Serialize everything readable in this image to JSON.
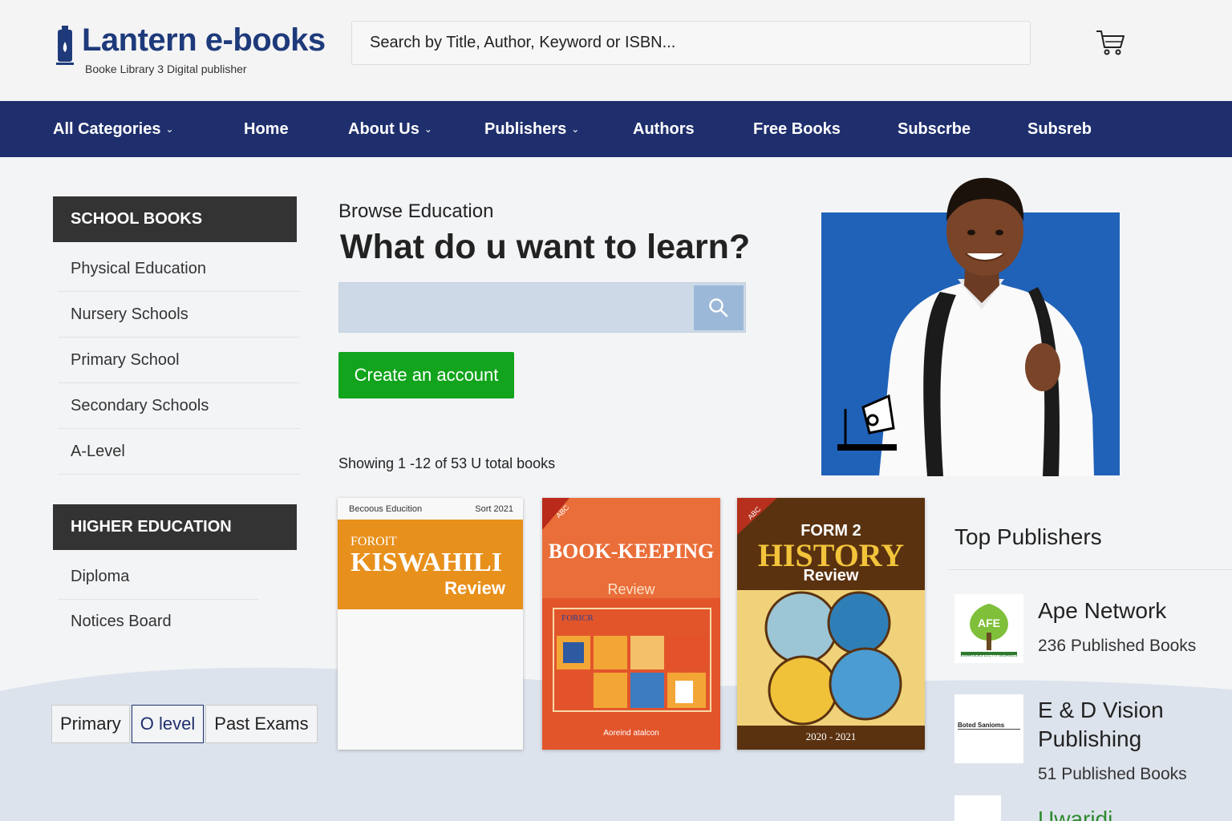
{
  "header": {
    "logo_title": "Lantern e-books",
    "logo_subtitle": "Booke Library 3 Digital publisher",
    "search_placeholder": "Search by Title, Author, Keyword or ISBN..."
  },
  "nav": {
    "items": [
      {
        "label": "All Categories",
        "dropdown": true
      },
      {
        "label": "Home",
        "dropdown": false
      },
      {
        "label": "About Us",
        "dropdown": true
      },
      {
        "label": "Publishers",
        "dropdown": true
      },
      {
        "label": "Authors",
        "dropdown": false
      },
      {
        "label": "Free Books",
        "dropdown": false
      },
      {
        "label": "Subscrbe",
        "dropdown": false
      },
      {
        "label": "Subsreb",
        "dropdown": false
      }
    ]
  },
  "sidebar": {
    "school_header": "SCHOOL BOOKS",
    "school_items": [
      "Physical Education",
      "Nursery Schools",
      "Primary School",
      "Secondary Schools",
      "A-Level"
    ],
    "higher_header": "HIGHER EDUCATION",
    "higher_items": [
      "Diploma",
      "Notices Board"
    ]
  },
  "tabs": [
    {
      "label": "Primary",
      "active": false
    },
    {
      "label": "O level",
      "active": true
    },
    {
      "label": "Past Exams",
      "active": false
    }
  ],
  "hero": {
    "browse_label": "Browse Education",
    "title": "What do u want to learn?",
    "create_account": "Create an account",
    "showing": "Showing 1 -12 of 53 U total books"
  },
  "books": [
    {
      "top_left": "Becoous Educition",
      "top_right": "Sort 2021",
      "kicker": "FOROIT",
      "title": "KISWAHILI",
      "subtitle": "Review",
      "color": "#e8901c"
    },
    {
      "badge": "ABC",
      "title": "BOOK-KEEPING",
      "subtitle": "Review",
      "panel_label": "FORICR",
      "footer": "Aoreind atalcon",
      "color": "#e2552b"
    },
    {
      "badge": "ABC",
      "kicker": "FORM 2",
      "title": "HISTORY",
      "subtitle": "Review",
      "footer": "2020 - 2021",
      "color": "#f0d27a"
    }
  ],
  "publishers": {
    "title": "Top Publishers",
    "items": [
      {
        "name": "Ape Network",
        "count": "236 Published Books",
        "logo_text": "AFE",
        "logo_caption": "EMARGLES LLC HT GIDAMDS"
      },
      {
        "name": "E & D Vision Publishing",
        "count": "51 Published Books",
        "logo_text": "Boted Sanioms"
      },
      {
        "name": "Uwaridi",
        "count": ""
      }
    ]
  },
  "colors": {
    "nav_bg": "#1f2f6d",
    "brand": "#1e3a7b",
    "cta_green": "#11a41c",
    "hero_blue": "#1f62b8",
    "sidebar_header": "#333333"
  }
}
